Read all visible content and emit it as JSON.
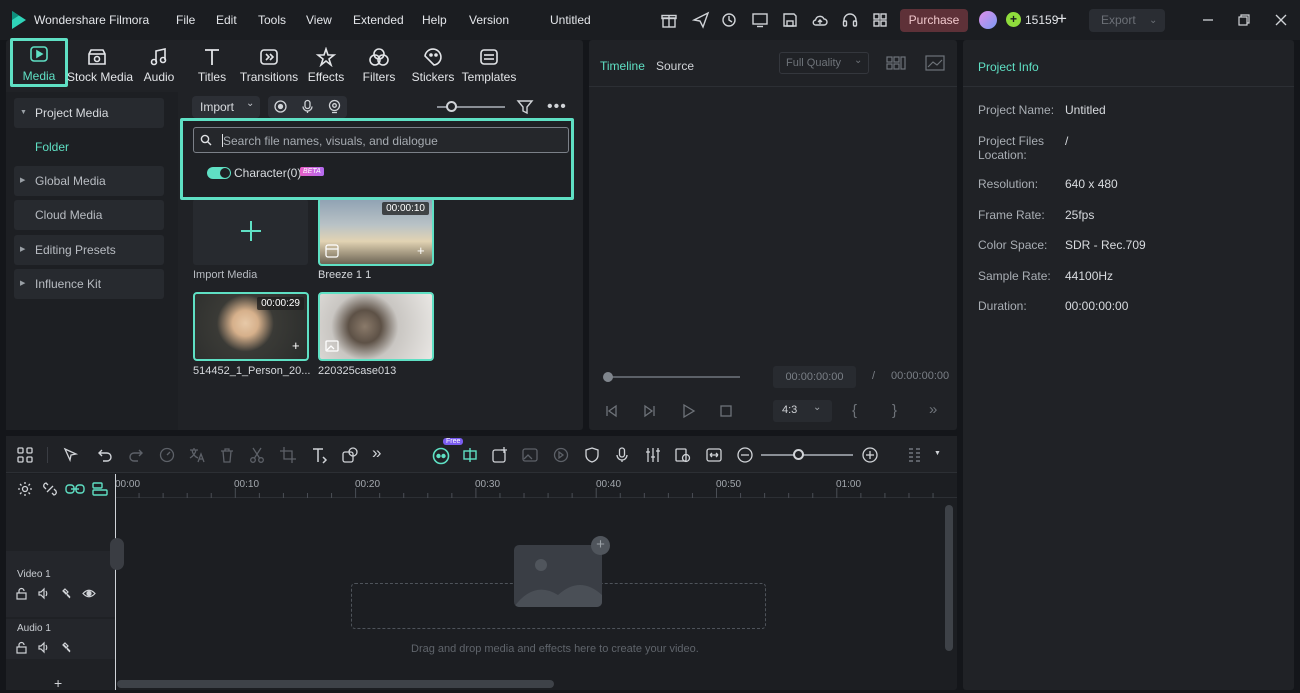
{
  "app": {
    "name": "Wondershare Filmora",
    "project_title": "Untitled"
  },
  "menu": [
    "File",
    "Edit",
    "Tools",
    "View",
    "Extended",
    "Help",
    "Version"
  ],
  "titlebar": {
    "purchase_label": "Purchase",
    "credits": "15159",
    "export_label": "Export"
  },
  "toolbar": {
    "tabs": [
      {
        "label": "Media",
        "icon": "media-icon",
        "active": true
      },
      {
        "label": "Stock Media",
        "icon": "stock-media-icon"
      },
      {
        "label": "Audio",
        "icon": "audio-icon"
      },
      {
        "label": "Titles",
        "icon": "titles-icon"
      },
      {
        "label": "Transitions",
        "icon": "transitions-icon"
      },
      {
        "label": "Effects",
        "icon": "effects-icon"
      },
      {
        "label": "Filters",
        "icon": "filters-icon"
      },
      {
        "label": "Stickers",
        "icon": "stickers-icon"
      },
      {
        "label": "Templates",
        "icon": "templates-icon"
      }
    ]
  },
  "sidebar": {
    "project_media": "Project Media",
    "folder": "Folder",
    "global_media": "Global Media",
    "cloud_media": "Cloud Media",
    "editing_presets": "Editing Presets",
    "influence_kit": "Influence Kit"
  },
  "media": {
    "import_label": "Import",
    "search_placeholder": "Search file names, visuals, and dialogue",
    "character_toggle_label": "Character(0)",
    "beta_badge": "BETA",
    "import_media_label": "Import Media",
    "items": [
      {
        "name": "Breeze 1 1",
        "duration": "00:00:10"
      },
      {
        "name": "514452_1_Person_20...",
        "duration": "00:00:29"
      },
      {
        "name": "220325case013",
        "duration": ""
      }
    ]
  },
  "player": {
    "tab_timeline": "Timeline",
    "tab_source": "Source",
    "quality": "Full Quality",
    "current_time": "00:00:00:00",
    "separator": "/",
    "total_time": "00:00:00:00",
    "aspect_ratio": "4:3"
  },
  "project_info": {
    "title": "Project Info",
    "name_label": "Project Name:",
    "name_value": "Untitled",
    "files_label_1": "Project Files",
    "files_label_2": "Location:",
    "files_value": "/",
    "resolution_label": "Resolution:",
    "resolution_value": "640 x 480",
    "frame_rate_label": "Frame Rate:",
    "frame_rate_value": "25fps",
    "color_space_label": "Color Space:",
    "color_space_value": "SDR - Rec.709",
    "sample_rate_label": "Sample Rate:",
    "sample_rate_value": "44100Hz",
    "duration_label": "Duration:",
    "duration_value": "00:00:00:00"
  },
  "timeline": {
    "free_badge": "Free",
    "ruler": [
      "00:00",
      "00:10",
      "00:20",
      "00:30",
      "00:40",
      "00:50",
      "01:00"
    ],
    "track_video": "Video 1",
    "track_audio": "Audio 1",
    "drop_hint": "Drag and drop media and effects here to create your video."
  },
  "colors": {
    "accent": "#5fe0c4",
    "purchase_bg": "#5e3138",
    "panel": "#202226",
    "background": "#14161a"
  }
}
